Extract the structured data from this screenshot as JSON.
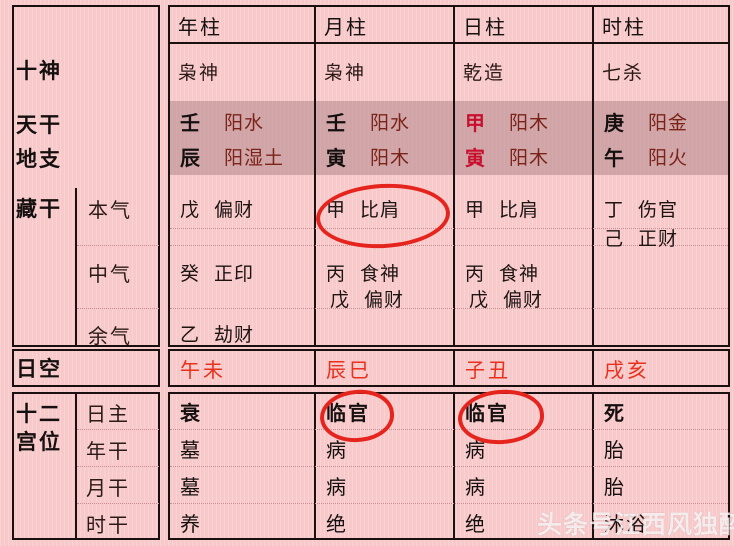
{
  "row_labels": {
    "ten_gods": "十神",
    "heaven_stem": "天干",
    "earth_branch": "地支",
    "hidden_stem": "藏干",
    "qi_main": "本气",
    "qi_middle": "中气",
    "qi_residual": "余气",
    "day_void": "日空",
    "twelve_palace": "十二宫位",
    "palace_rows": [
      "日主",
      "年干",
      "月干",
      "时干"
    ]
  },
  "pillars": {
    "headers": [
      "年柱",
      "月柱",
      "日柱",
      "时柱"
    ],
    "ten_gods": [
      "枭神",
      "枭神",
      "乾造",
      "七杀"
    ],
    "stems": [
      {
        "char": "壬",
        "element": "阳水",
        "highlight": false
      },
      {
        "char": "壬",
        "element": "阳水",
        "highlight": false
      },
      {
        "char": "甲",
        "element": "阳木",
        "highlight": true
      },
      {
        "char": "庚",
        "element": "阳金",
        "highlight": false
      }
    ],
    "branches": [
      {
        "char": "辰",
        "element": "阳湿土",
        "highlight": false
      },
      {
        "char": "寅",
        "element": "阳木",
        "highlight": false
      },
      {
        "char": "寅",
        "element": "阳木",
        "highlight": true
      },
      {
        "char": "午",
        "element": "阳火",
        "highlight": false
      }
    ],
    "hidden": {
      "main": [
        [
          {
            "g": "戊",
            "t": "偏财"
          }
        ],
        [
          {
            "g": "甲",
            "t": "比肩"
          }
        ],
        [
          {
            "g": "甲",
            "t": "比肩"
          }
        ],
        [
          {
            "g": "丁",
            "t": "伤官"
          },
          {
            "g": "己",
            "t": "正财"
          }
        ]
      ],
      "middle": [
        [
          {
            "g": "癸",
            "t": "正印"
          }
        ],
        [
          {
            "g": "丙",
            "t": "食神"
          },
          {
            "g": "戊",
            "t": "偏财"
          }
        ],
        [
          {
            "g": "丙",
            "t": "食神"
          },
          {
            "g": "戊",
            "t": "偏财"
          }
        ],
        []
      ],
      "residual": [
        [
          {
            "g": "乙",
            "t": "劫财"
          }
        ],
        [],
        [],
        []
      ]
    },
    "day_void": [
      "午未",
      "辰巳",
      "子丑",
      "戌亥"
    ],
    "twelve_palace": [
      [
        "衰",
        "临官",
        "临官",
        "死"
      ],
      [
        "墓",
        "病",
        "病",
        "胎"
      ],
      [
        "墓",
        "病",
        "病",
        "胎"
      ],
      [
        "养",
        "绝",
        "绝",
        "沐浴"
      ]
    ]
  },
  "annotations": {
    "circles": [
      "month-hidden-main-circle",
      "month-palace-circle",
      "day-palace-circle"
    ],
    "circle_color": "#e5241d"
  },
  "watermark": "头条号江西风独醉",
  "colors": {
    "background": "#f8c9ca",
    "border": "#1a1010",
    "void_text": "#e8301c",
    "day_stem_text": "#c8102e",
    "element_text": "#7b2318",
    "highlight_band": "rgba(120,80,85,0.30)"
  }
}
